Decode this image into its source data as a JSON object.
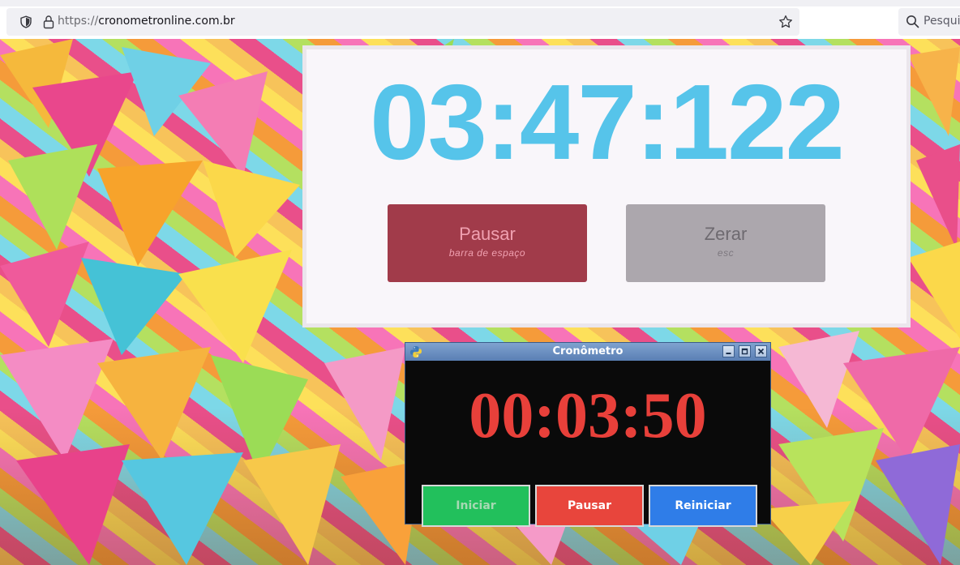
{
  "browser": {
    "url_scheme": "https://",
    "url_host": "cronometronline.com.br",
    "search_placeholder": "Pesqui",
    "icons": [
      "shield-icon",
      "lock-icon",
      "bookmark-star-icon",
      "search-icon"
    ]
  },
  "web_stopwatch": {
    "time": "03:47:122",
    "pause_button": {
      "label": "Pausar",
      "shortcut": "barra de espaço"
    },
    "reset_button": {
      "label": "Zerar",
      "shortcut": "esc"
    },
    "colors": {
      "time": "#56c4ea",
      "pause": "#a13b4a",
      "reset": "#aca7ad"
    }
  },
  "app_window": {
    "title": "Cronômetro",
    "time": "00:03:50",
    "buttons": {
      "start": "Iniciar",
      "pause": "Pausar",
      "restart": "Reiniciar"
    },
    "colors": {
      "time": "#e8403a",
      "start": "#22c05c",
      "pause": "#e8453c",
      "restart": "#2f7de8"
    },
    "titlebar_icons": [
      "python-icon",
      "minimize-icon",
      "maximize-icon",
      "close-icon"
    ]
  }
}
